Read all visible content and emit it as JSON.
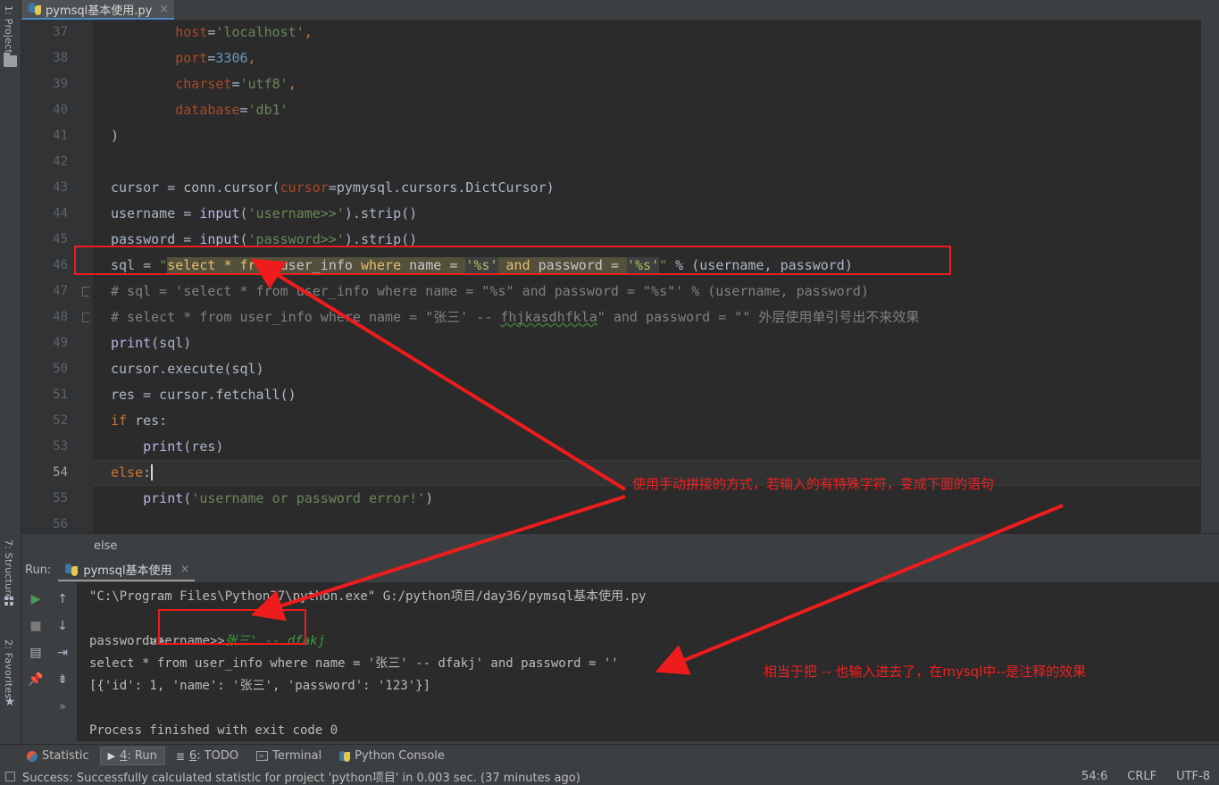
{
  "window": {
    "editor_tab": {
      "title": "pymsql基本使用.py",
      "close_glyph": "×",
      "icon": "python-file-icon"
    }
  },
  "left_strip": {
    "project": "1: Project",
    "structure": "7: Structure",
    "favorites": "2: Favorites",
    "star_glyph": "★"
  },
  "editor": {
    "lines": [
      {
        "n": "37",
        "indent": 2
      },
      {
        "n": "38",
        "indent": 2
      },
      {
        "n": "39",
        "indent": 2
      },
      {
        "n": "40",
        "indent": 2
      },
      {
        "n": "41",
        "indent": 0
      },
      {
        "n": "42",
        "indent": 0
      },
      {
        "n": "43",
        "indent": 0
      },
      {
        "n": "44",
        "indent": 0
      },
      {
        "n": "45",
        "indent": 0
      },
      {
        "n": "46",
        "indent": 0
      },
      {
        "n": "47",
        "indent": 0
      },
      {
        "n": "48",
        "indent": 0
      },
      {
        "n": "49",
        "indent": 0
      },
      {
        "n": "50",
        "indent": 0
      },
      {
        "n": "51",
        "indent": 0
      },
      {
        "n": "52",
        "indent": 0
      },
      {
        "n": "53",
        "indent": 1
      },
      {
        "n": "54",
        "indent": 0
      },
      {
        "n": "55",
        "indent": 1
      },
      {
        "n": "56",
        "indent": 0
      }
    ],
    "line_numbers": [
      "37",
      "38",
      "39",
      "40",
      "41",
      "42",
      "43",
      "44",
      "45",
      "46",
      "47",
      "48",
      "49",
      "50",
      "51",
      "52",
      "53",
      "54",
      "55",
      "56"
    ],
    "current_line": "54",
    "code_text": {
      "l37": "        host='localhost',",
      "l38": "        port=3306,",
      "l39": "        charset='utf8',",
      "l40": "        database='db1'",
      "l41": "    )",
      "l42": "",
      "l43": "    cursor = conn.cursor(cursor=pymysql.cursors.DictCursor)",
      "l44": "    username = input('username>>').strip()",
      "l45": "    password = input('password>>').strip()",
      "l46": "    sql = \"select * from user_info where name = '%s' and password = '%s'\" % (username, password)",
      "l47": "    # sql = 'select * from user_info where name = \"%s\" and password = \"%s\"' % (username, password)",
      "l48": "    # select * from user_info where name = \"张三' -- fhjkasdhfkla\" and password = \"\" 外层使用单引号出不来效果",
      "l49": "    print(sql)",
      "l50": "    cursor.execute(sql)",
      "l51": "    res = cursor.fetchall()",
      "l52": "    if res:",
      "l53": "        print(res)",
      "l54": "    else:",
      "l55": "        print('username or password error!')",
      "l56": ""
    },
    "tokens": {
      "host_key": "host",
      "host_val": "'localhost'",
      "port_key": "port",
      "port_val": "3306",
      "charset_key": "charset",
      "charset_val": "'utf8'",
      "database_key": "database",
      "database_val": "'db1'",
      "close_paren": ")",
      "cursor_var": "cursor",
      "conn_cursor": "conn.cursor(",
      "cursor_kw": "cursor",
      "dictcursor": "=pymysql.cursors.DictCursor)",
      "username_var": "username = ",
      "input_fn": "input",
      "username_prompt": "'username>>'",
      "strip_call": ").strip()",
      "password_var": "password = ",
      "password_prompt": "'password>>'",
      "sql_var": "sql = ",
      "quote": "\"",
      "sql_select": "select",
      "sql_star": "*",
      "sql_from": "from",
      "sql_table": "user_info",
      "sql_where": "where",
      "sql_name": "name",
      "sql_eq": "=",
      "sql_pct1": "'%s'",
      "sql_and": "and",
      "sql_pw": "password",
      "sql_pct2": "'%s'",
      "sql_fmt": " % (username, password)",
      "comment_47": "# sql = 'select * from user_info where name = \"%s\" and password = \"%s\"' % (username, password)",
      "comment_48_a": "# select * from user_info where name = \"张三' -- ",
      "comment_48_b": "fhjkasdhfkla",
      "comment_48_c": "\" and password = \"\" 外层使用单引号出不来效果",
      "print_fn": "print",
      "print_sql": "(sql)",
      "cursor_exec": "cursor.execute(sql)",
      "res_assign": "res = cursor.fetchall()",
      "kw_if": "if",
      "if_rest": " res:",
      "print_res": "(res)",
      "kw_else": "else",
      "else_colon": ":",
      "print_err_str": "'username or password error!'",
      "print_open": "(",
      "print_close": ")"
    }
  },
  "breadcrumb": {
    "text": "else"
  },
  "run_window": {
    "label": "Run:",
    "tab_title": "pymsql基本使用",
    "tab_close": "×",
    "buttons": [
      {
        "name": "rerun-button",
        "glyph": "▶"
      },
      {
        "name": "stop-button",
        "glyph": "■"
      },
      {
        "name": "print-button",
        "glyph": "▤"
      },
      {
        "name": "pin-button",
        "glyph": "📌"
      },
      {
        "name": "up-stacktrace-button",
        "glyph": "↑"
      },
      {
        "name": "down-stacktrace-button",
        "glyph": "↓"
      },
      {
        "name": "soft-wrap-button",
        "glyph": "⇥"
      },
      {
        "name": "scroll-to-end-button",
        "glyph": "⇟"
      },
      {
        "name": "more-button",
        "glyph": "»"
      }
    ],
    "console": {
      "cmd": "\"C:\\Program Files\\Python37\\python.exe\" G:/python项目/day36/pymsql基本使用.py",
      "username_prompt": "username>>",
      "username_input": "张三' -- dfakj",
      "password_prompt": "password>>",
      "sql_echo": "select * from user_info where name = '张三' -- dfakj' and password = ''",
      "result": "[{'id': 1, 'name': '张三', 'password': '123'}]",
      "finished": "Process finished with exit code 0"
    }
  },
  "bottom_bar": {
    "items": [
      {
        "label": "Statistic",
        "prefix": "",
        "icon": "statistic-icon",
        "active": false
      },
      {
        "label": ": Run",
        "prefix": "4",
        "icon": "run-icon",
        "active": true
      },
      {
        "label": ": TODO",
        "prefix": "6",
        "icon": "todo-icon",
        "active": false
      },
      {
        "label": "Terminal",
        "prefix": "",
        "icon": "terminal-icon",
        "active": false
      },
      {
        "label": "Python Console",
        "prefix": "",
        "icon": "python-console-icon",
        "active": false
      }
    ]
  },
  "status_bar": {
    "message": "Success: Successfully calculated statistic for project 'python项目' in 0.003 sec. (37 minutes ago)",
    "caret": "54:6",
    "line_separator": "CRLF",
    "encoding": "UTF-8"
  },
  "annotations": {
    "note_top": "使用手动拼接的方式，若输入的有特殊字符，变成下面的语句",
    "note_bottom": "相当于把 -- 也输入进去了，在mysql中--是注释的效果",
    "color": "#ee1c1c"
  }
}
